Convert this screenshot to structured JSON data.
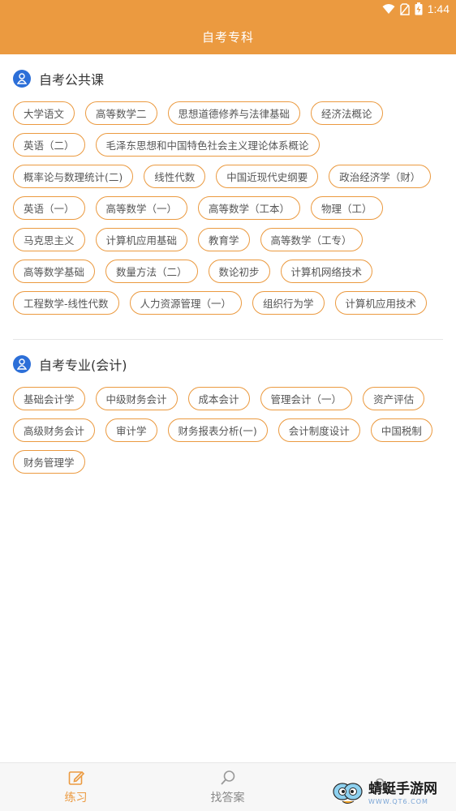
{
  "status_bar": {
    "time": "1:44"
  },
  "app_bar": {
    "title": "自考专科"
  },
  "sections": [
    {
      "title": "自考公共课",
      "tags": [
        "大学语文",
        "高等数学二",
        "思想道德修养与法律基础",
        "经济法概论",
        "英语（二）",
        "毛泽东思想和中国特色社会主义理论体系概论",
        "概率论与数理统计(二)",
        "线性代数",
        "中国近现代史纲要",
        "政治经济学（财）",
        "英语（一）",
        "高等数学（一）",
        "高等数学（工本）",
        "物理（工）",
        "马克思主义",
        "计算机应用基础",
        "教育学",
        "高等数学（工专）",
        "高等数学基础",
        "数量方法（二）",
        "数论初步",
        "计算机网络技术",
        "工程数学-线性代数",
        "人力资源管理（一）",
        "组织行为学",
        "计算机应用技术"
      ]
    },
    {
      "title": "自考专业(会计)",
      "tags": [
        "基础会计学",
        "中级财务会计",
        "成本会计",
        "管理会计（一）",
        "资产评估",
        "高级财务会计",
        "审计学",
        "财务报表分析(一)",
        "会计制度设计",
        "中国税制",
        "财务管理学"
      ]
    }
  ],
  "bottom_nav": [
    {
      "label": "练习",
      "icon": "edit-icon",
      "active": true
    },
    {
      "label": "找答案",
      "icon": "search-icon",
      "active": false
    },
    {
      "label": "",
      "icon": "user-icon",
      "active": false
    }
  ],
  "watermark": {
    "title": "蜻蜓手游网",
    "url": "WWW.QT6.COM"
  },
  "colors": {
    "accent": "#eb9a40",
    "section_icon": "#2c6fd8"
  }
}
